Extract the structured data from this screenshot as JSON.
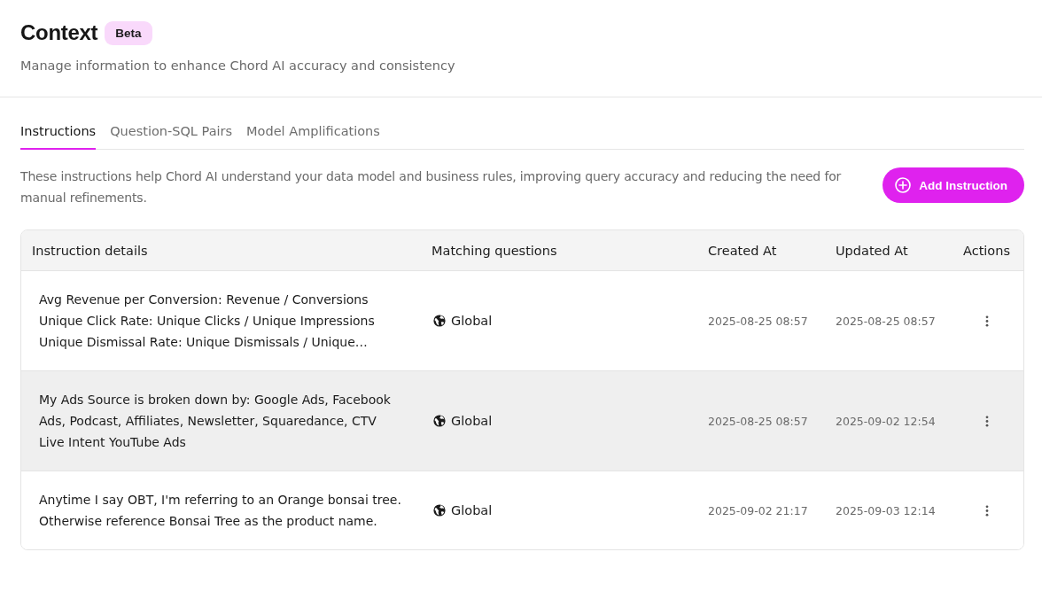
{
  "page": {
    "title": "Context",
    "badge": "Beta",
    "subtitle": "Manage information to enhance Chord AI accuracy and consistency"
  },
  "tabs": [
    {
      "label": "Instructions",
      "selected": true
    },
    {
      "label": "Question-SQL Pairs",
      "selected": false
    },
    {
      "label": "Model Amplifications",
      "selected": false
    }
  ],
  "intro": {
    "description": "These instructions help Chord AI understand your data model and business rules, improving query accuracy and reducing the need for manual refinements.",
    "button": "Add Instruction"
  },
  "table": {
    "columns": [
      "Instruction details",
      "Matching questions",
      "Created At",
      "Updated At",
      "Actions"
    ],
    "rows": [
      {
        "instruction": "Avg Revenue per Conversion: Revenue / Conversions\nUnique Click Rate: Unique Clicks / Unique Impressions\nUnique Dismissal Rate: Unique Dismissals / Unique…",
        "scope": "Global",
        "created_at": "2025-08-25 08:57",
        "updated_at": "2025-08-25 08:57",
        "hovered": false
      },
      {
        "instruction": "My Ads Source is broken down by: Google Ads, Facebook Ads, Podcast, Affiliates, Newsletter, Squaredance, CTV Live Intent YouTube Ads",
        "scope": "Global",
        "created_at": "2025-08-25 08:57",
        "updated_at": "2025-09-02 12:54",
        "hovered": true
      },
      {
        "instruction": "Anytime I say OBT, I'm referring to an Orange bonsai tree. Otherwise reference Bonsai Tree as the product name.",
        "scope": "Global",
        "created_at": "2025-09-02 21:17",
        "updated_at": "2025-09-03 12:14",
        "hovered": false
      }
    ]
  }
}
